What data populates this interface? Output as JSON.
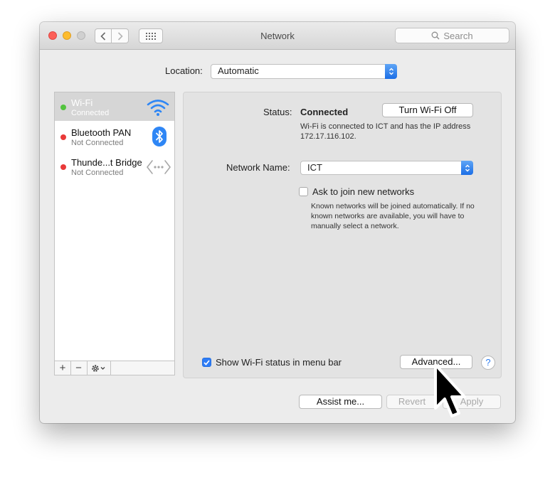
{
  "window": {
    "title": "Network",
    "search_placeholder": "Search"
  },
  "location": {
    "label": "Location:",
    "value": "Automatic"
  },
  "services": [
    {
      "name": "Wi-Fi",
      "status": "Connected",
      "icon": "wifi-icon"
    },
    {
      "name": "Bluetooth PAN",
      "status": "Not Connected",
      "icon": "bluetooth-icon"
    },
    {
      "name": "Thunde...t Bridge",
      "status": "Not Connected",
      "icon": "thunderbolt-bridge-icon"
    }
  ],
  "sidebar_toolbar": {
    "add": "+",
    "remove": "−"
  },
  "detail": {
    "status_label": "Status:",
    "status_value": "Connected",
    "turn_off_button": "Turn Wi-Fi Off",
    "status_description": "Wi-Fi is connected to ICT and has the IP address 172.17.116.102.",
    "network_name_label": "Network Name:",
    "network_name_value": "ICT",
    "ask_join_label": "Ask to join new networks",
    "ask_join_checked": false,
    "ask_join_description": "Known networks will be joined automatically. If no known networks are available, you will have to manually select a network.",
    "show_status_label": "Show Wi-Fi status in menu bar",
    "show_status_checked": true,
    "advanced_button": "Advanced...",
    "help_button": "?"
  },
  "footer": {
    "assist_button": "Assist me...",
    "revert_button": "Revert",
    "apply_button": "Apply"
  },
  "colors": {
    "accent": "#2e7cf6",
    "connected": "#52c33e",
    "not_connected": "#e93a39",
    "selection": "#d6d6d6"
  }
}
